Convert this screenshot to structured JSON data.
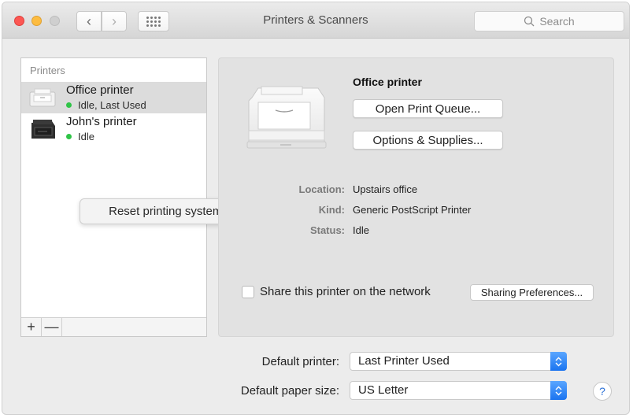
{
  "window": {
    "title": "Printers & Scanners",
    "search_placeholder": "Search"
  },
  "toolbar": {
    "back_icon": "chevron-left",
    "forward_icon": "chevron-right",
    "grid_icon": "show-all-grid"
  },
  "printer_list": {
    "header": "Printers",
    "items": [
      {
        "name": "Office printer",
        "status": "Idle, Last Used",
        "status_color": "#2fc447",
        "selected": true
      },
      {
        "name": "John's printer",
        "status": "Idle",
        "status_color": "#2fc447",
        "selected": false
      }
    ],
    "add_label": "+",
    "remove_label": "—"
  },
  "context_menu": {
    "item": "Reset printing system..."
  },
  "detail": {
    "printer_name": "Office printer",
    "open_queue_label": "Open Print Queue...",
    "options_label": "Options & Supplies...",
    "info": [
      {
        "label": "Location:",
        "value": "Upstairs office"
      },
      {
        "label": "Kind:",
        "value": "Generic PostScript Printer"
      },
      {
        "label": "Status:",
        "value": "Idle"
      }
    ],
    "share_label": "Share this printer on the network",
    "share_checked": false,
    "sharing_prefs_label": "Sharing Preferences..."
  },
  "settings": {
    "default_printer_label": "Default printer:",
    "default_printer_value": "Last Printer Used",
    "default_paper_label": "Default paper size:",
    "default_paper_value": "US Letter",
    "help_label": "?"
  },
  "colors": {
    "accent": "#1a74f0",
    "status_green": "#2fc447",
    "close": "#fc5753",
    "minimize": "#fdbc40"
  }
}
